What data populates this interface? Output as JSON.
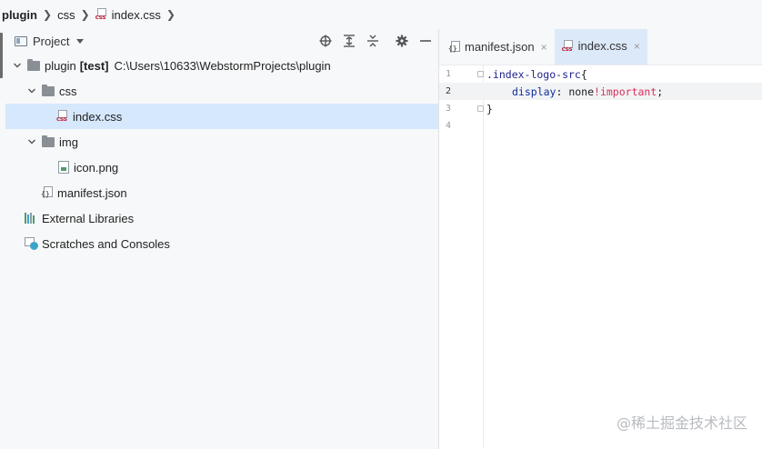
{
  "breadcrumb": {
    "items": [
      {
        "label": "plugin"
      },
      {
        "label": "css"
      },
      {
        "label": "index.css",
        "icon": "css-file-icon"
      }
    ]
  },
  "sidebar": {
    "strip_label": "Project"
  },
  "project_panel": {
    "title": "Project",
    "toolbar_icons": [
      "locate-icon",
      "expand-all-icon",
      "collapse-all-icon",
      "gear-icon",
      "minimize-icon"
    ],
    "tree": {
      "root": {
        "name": "plugin",
        "badge": "[test]",
        "path": "C:\\Users\\10633\\WebstormProjects\\plugin"
      },
      "css_folder": "css",
      "index_css": "index.css",
      "img_folder": "img",
      "icon_png": "icon.png",
      "manifest": "manifest.json",
      "external_libraries": "External Libraries",
      "scratches": "Scratches and Consoles"
    }
  },
  "editor": {
    "tabs": [
      {
        "label": "manifest.json",
        "active": false
      },
      {
        "label": "index.css",
        "active": true
      }
    ],
    "close_glyph": "×",
    "lines": [
      {
        "num": "1",
        "selector": ".index-logo-src",
        "open": "{"
      },
      {
        "num": "2",
        "property": "display",
        "colon": ":",
        "value": " none",
        "important": "!important",
        "semicolon": ";"
      },
      {
        "num": "3",
        "close": "}"
      },
      {
        "num": "4"
      }
    ],
    "current_line": 2
  },
  "watermark": "@稀土掘金技术社区",
  "colors": {
    "selection": "#d5e8fc",
    "active_tab": "#dce9f8",
    "important": "#d7315b",
    "property": "#0c2ea0"
  }
}
